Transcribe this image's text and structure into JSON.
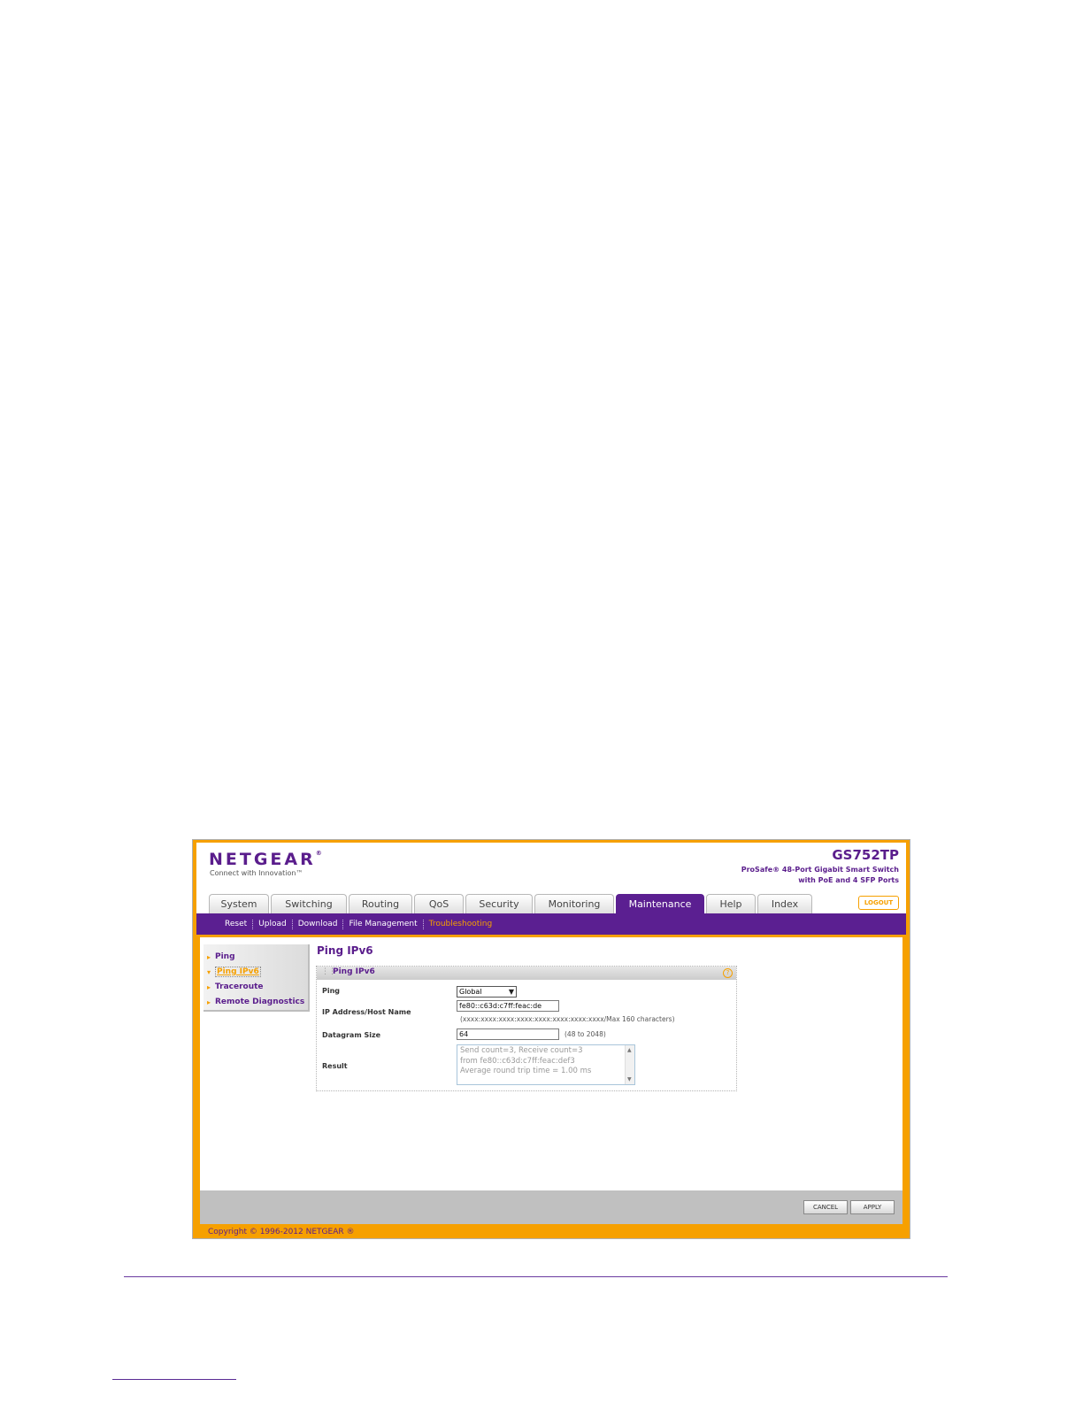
{
  "brand": {
    "logo": "NETGEAR",
    "logo_mark": "®",
    "tagline": "Connect with Innovation™",
    "model": "GS752TP",
    "description_line1": "ProSafe® 48-Port Gigabit Smart Switch",
    "description_line2": "with PoE and 4 SFP Ports"
  },
  "tabs": [
    {
      "label": "System"
    },
    {
      "label": "Switching"
    },
    {
      "label": "Routing"
    },
    {
      "label": "QoS"
    },
    {
      "label": "Security"
    },
    {
      "label": "Monitoring"
    },
    {
      "label": "Maintenance"
    },
    {
      "label": "Help"
    },
    {
      "label": "Index"
    }
  ],
  "logout_label": "LOGOUT",
  "subnav": [
    {
      "label": "Reset"
    },
    {
      "label": "Upload"
    },
    {
      "label": "Download"
    },
    {
      "label": "File Management"
    },
    {
      "label": "Troubleshooting"
    }
  ],
  "leftnav": [
    {
      "label": "Ping"
    },
    {
      "label": "Ping IPv6"
    },
    {
      "label": "Traceroute"
    },
    {
      "label": "Remote Diagnostics"
    }
  ],
  "page_title": "Ping IPv6",
  "panel": {
    "title": "Ping IPv6",
    "help_glyph": "?",
    "ping_label": "Ping",
    "ping_value": "Global",
    "ip_label": "IP Address/Host Name",
    "ip_value": "fe80::c63d:c7ff:feac:de",
    "ip_hint": "(xxxx:xxxx:xxxx:xxxx:xxxx:xxxx:xxxx:xxxx/Max 160 characters)",
    "datagram_label": "Datagram Size",
    "datagram_value": "64",
    "datagram_hint": "(48 to 2048)",
    "result_label": "Result",
    "result_lines": [
      "Send count=3, Receive count=3",
      "from fe80::c63d:c7ff:feac:def3",
      "Average round trip time = 1.00 ms"
    ]
  },
  "buttons": {
    "cancel": "CANCEL",
    "apply": "APPLY"
  },
  "copyright": "Copyright © 1996-2012 NETGEAR ®",
  "colors": {
    "frame": "#f6a000",
    "brand_purple": "#5b1f91",
    "footer_bar": "#c0c0c0"
  }
}
